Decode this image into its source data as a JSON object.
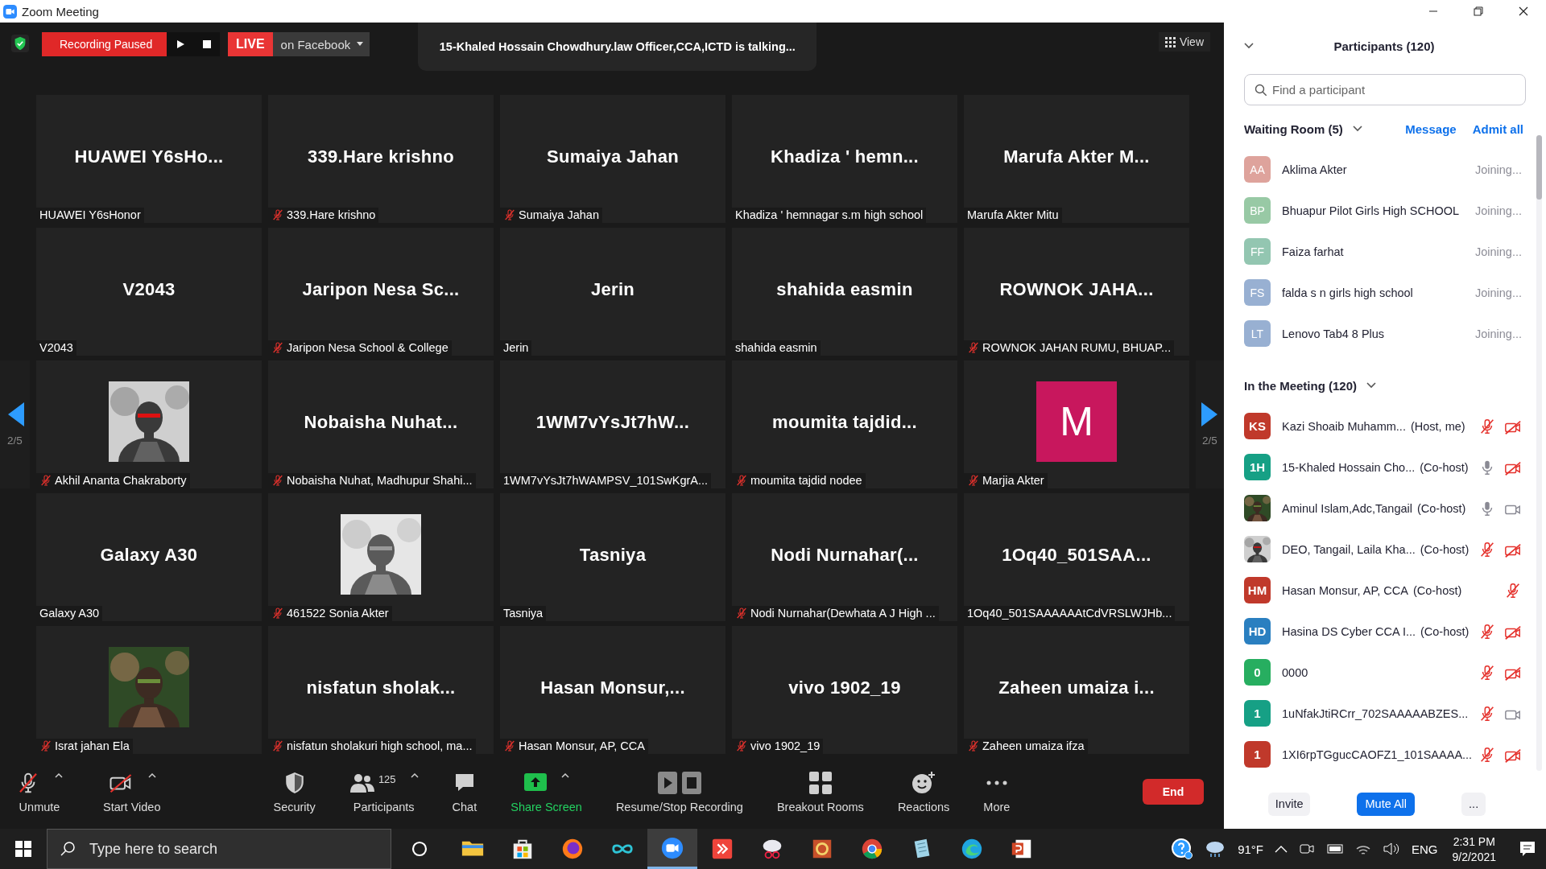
{
  "window": {
    "title": "Zoom Meeting"
  },
  "top_bar": {
    "recording": "Recording Paused",
    "live": "LIVE",
    "live_target": "on Facebook",
    "talking": "15-Khaled Hossain Chowdhury.law Officer,CCA,ICTD is talking...",
    "view": "View"
  },
  "pager": {
    "left": "2/5",
    "right": "2/5"
  },
  "tiles": [
    {
      "kind": "name",
      "display": "HUAWEI Y6sHo...",
      "caption": "HUAWEI Y6sHonor",
      "muted": false
    },
    {
      "kind": "name",
      "display": "339.Hare krishno",
      "caption": "339.Hare krishno",
      "muted": true
    },
    {
      "kind": "name",
      "display": "Sumaiya Jahan",
      "caption": "Sumaiya Jahan",
      "muted": true
    },
    {
      "kind": "name",
      "display": "Khadiza ' hemn...",
      "caption": "Khadiza ' hemnagar s.m high school",
      "muted": false
    },
    {
      "kind": "name",
      "display": "Marufa Akter M...",
      "caption": "Marufa Akter Mitu",
      "muted": false
    },
    {
      "kind": "name",
      "display": "V2043",
      "caption": "V2043",
      "muted": false
    },
    {
      "kind": "name",
      "display": "Jaripon Nesa Sc...",
      "caption": "Jaripon Nesa School & College",
      "muted": true
    },
    {
      "kind": "name",
      "display": "Jerin",
      "caption": "Jerin",
      "muted": false
    },
    {
      "kind": "name",
      "display": "shahida easmin",
      "caption": "shahida easmin",
      "muted": false
    },
    {
      "kind": "name",
      "display": "ROWNOK JAHA...",
      "caption": "ROWNOK JAHAN RUMU, BHUAP...",
      "muted": true
    },
    {
      "kind": "picture",
      "caption": "Akhil Ananta Chakraborty",
      "muted": true
    },
    {
      "kind": "name",
      "display": "Nobaisha Nuhat...",
      "caption": "Nobaisha Nuhat, Madhupur Shahi...",
      "muted": true
    },
    {
      "kind": "name",
      "display": "1WM7vYsJt7hW...",
      "caption": "1WM7vYsJt7hWAMPSV_101SwKgrA...",
      "muted": false
    },
    {
      "kind": "name",
      "display": "moumita tajdid...",
      "caption": "moumita tajdid nodee",
      "muted": true
    },
    {
      "kind": "avatar",
      "display": "M",
      "color": "#c8175d",
      "caption": "Marjia Akter",
      "muted": true
    },
    {
      "kind": "name",
      "display": "Galaxy A30",
      "caption": "Galaxy A30",
      "muted": false
    },
    {
      "kind": "picture",
      "caption": "461522 Sonia Akter",
      "muted": true
    },
    {
      "kind": "name",
      "display": "Tasniya",
      "caption": "Tasniya",
      "muted": false
    },
    {
      "kind": "name",
      "display": "Nodi Nurnahar(...",
      "caption": "Nodi Nurnahar(Dewhata A J High ...",
      "muted": true
    },
    {
      "kind": "name",
      "display": "1Oq40_501SAA...",
      "caption": "1Oq40_501SAAAAAAtCdVRSLWJHb...",
      "muted": false
    },
    {
      "kind": "picture",
      "caption": "Israt jahan Ela",
      "muted": true
    },
    {
      "kind": "name",
      "display": "nisfatun sholak...",
      "caption": "nisfatun sholakuri high school, ma...",
      "muted": true
    },
    {
      "kind": "name",
      "display": "Hasan Monsur,...",
      "caption": "Hasan Monsur, AP, CCA",
      "muted": true
    },
    {
      "kind": "name",
      "display": "vivo 1902_19",
      "caption": "vivo 1902_19",
      "muted": true
    },
    {
      "kind": "name",
      "display": "Zaheen umaiza i...",
      "caption": "Zaheen umaiza ifza",
      "muted": true
    }
  ],
  "toolbar": {
    "items": [
      {
        "kind": "unmute",
        "label": "Unmute",
        "caret": true
      },
      {
        "kind": "video",
        "label": "Start Video",
        "caret": true
      },
      {
        "kind": "security",
        "label": "Security",
        "caret": false
      },
      {
        "kind": "participants",
        "label": "Participants",
        "count": "125",
        "caret": true
      },
      {
        "kind": "chat",
        "label": "Chat",
        "caret": false
      },
      {
        "kind": "share",
        "label": "Share Screen",
        "caret": true
      },
      {
        "kind": "record",
        "label": "Resume/Stop Recording",
        "caret": false
      },
      {
        "kind": "breakout",
        "label": "Breakout Rooms",
        "caret": false
      },
      {
        "kind": "reactions",
        "label": "Reactions",
        "caret": false
      },
      {
        "kind": "more",
        "label": "More",
        "caret": false
      }
    ],
    "end": "End"
  },
  "panel": {
    "title": "Participants (120)",
    "search": {
      "placeholder": "Find a participant"
    },
    "waiting": {
      "title": "Waiting Room (5)",
      "message": "Message",
      "admit": "Admit all",
      "people": [
        {
          "initials": "AA",
          "color": "#dea39c",
          "name": "Aklima Akter",
          "status": "Joining..."
        },
        {
          "initials": "BP",
          "color": "#98c9a5",
          "name": "Bhuapur Pilot Girls High SCHOOL",
          "status": "Joining..."
        },
        {
          "initials": "FF",
          "color": "#93c6b1",
          "name": "Faiza farhat",
          "status": "Joining..."
        },
        {
          "initials": "FS",
          "color": "#98b0d2",
          "name": "falda s n girls high school",
          "status": "Joining..."
        },
        {
          "initials": "LT",
          "color": "#98b0d2",
          "name": "Lenovo Tab4 8 Plus",
          "status": "Joining..."
        }
      ]
    },
    "meeting": {
      "title": "In the Meeting (120)",
      "people": [
        {
          "kind": "initials",
          "initials": "KS",
          "color": "#c0392b",
          "name": "Kazi Shoaib Muhamm...",
          "role": "(Host, me)",
          "muted": true,
          "video_off": true
        },
        {
          "kind": "initials",
          "initials": "1H",
          "color": "#16a085",
          "name": "15-Khaled Hossain Cho...",
          "role": "(Co-host)",
          "muted": false,
          "video_off": true
        },
        {
          "kind": "picture",
          "name": "Aminul Islam,Adc,Tangail",
          "role": "(Co-host)",
          "muted": false,
          "video_off": false
        },
        {
          "kind": "picture",
          "name": "DEO, Tangail, Laila Kha...",
          "role": "(Co-host)",
          "muted": true,
          "video_off": true
        },
        {
          "kind": "initials",
          "initials": "HM",
          "color": "#c0392b",
          "name": "Hasan Monsur, AP, CCA",
          "role": "(Co-host)",
          "muted": true
        },
        {
          "kind": "initials",
          "initials": "HD",
          "color": "#2a7fc0",
          "name": "Hasina DS Cyber CCA I...",
          "role": "(Co-host)",
          "muted": true,
          "video_off": true
        },
        {
          "kind": "initials",
          "initials": "0",
          "color": "#27ae60",
          "name": "0000",
          "muted": true,
          "video_off": true
        },
        {
          "kind": "initials",
          "initials": "1",
          "color": "#16a085",
          "name": "1uNfakJtiRCrr_702SAAAAABZES...",
          "muted": true,
          "video_off": false
        },
        {
          "kind": "initials",
          "initials": "1",
          "color": "#c0392b",
          "name": "1XI6rpTGgucCAOFZ1_101SAAAA...",
          "muted": true,
          "video_off": true
        }
      ]
    },
    "buttons": [
      "Invite",
      "Mute All",
      "..."
    ]
  },
  "taskbar": {
    "search": {
      "placeholder": "Type here to search"
    },
    "apps": [
      {
        "kind": "folder",
        "selected": false
      },
      {
        "kind": "store",
        "selected": false
      },
      {
        "kind": "firefox",
        "selected": false
      },
      {
        "kind": "infinity",
        "selected": false
      },
      {
        "kind": "zoom",
        "selected": true
      },
      {
        "kind": "anydesk",
        "selected": false
      },
      {
        "kind": "snip",
        "selected": false
      },
      {
        "kind": "bengali",
        "selected": false
      },
      {
        "kind": "chrome",
        "selected": false
      },
      {
        "kind": "notepad",
        "selected": false
      },
      {
        "kind": "edge",
        "selected": false
      },
      {
        "kind": "powerpoint",
        "selected": false
      }
    ],
    "weather": "91°F",
    "language": "ENG",
    "time": "2:31 PM",
    "date": "9/2/2021"
  }
}
